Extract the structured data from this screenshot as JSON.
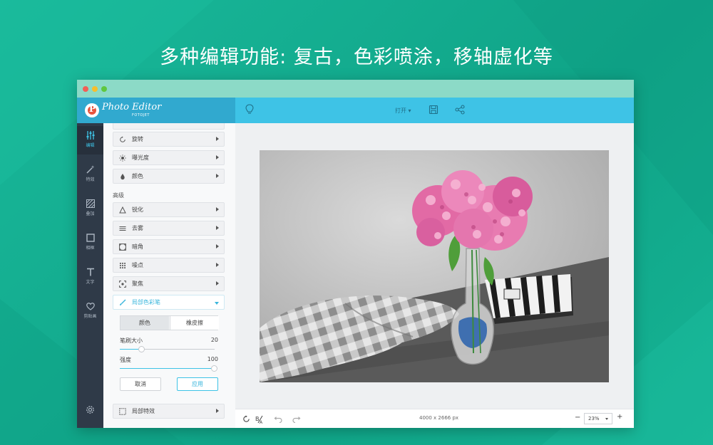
{
  "headline": "多种编辑功能: 复古，色彩喷涂，移轴虚化等",
  "app": {
    "brand_name": "Photo Editor",
    "brand_sub": "FOTOJET",
    "open_menu": "打开 ▾"
  },
  "rail": {
    "items": [
      {
        "label": "编辑",
        "icon": "sliders-icon"
      },
      {
        "label": "特效",
        "icon": "magic-wand-icon"
      },
      {
        "label": "叠加",
        "icon": "overlay-icon"
      },
      {
        "label": "相框",
        "icon": "frame-icon"
      },
      {
        "label": "文字",
        "icon": "text-icon"
      },
      {
        "label": "剪贴画",
        "icon": "heart-icon"
      }
    ]
  },
  "panel": {
    "basic_items": [
      {
        "label": "旋转",
        "icon": "rotate-icon"
      },
      {
        "label": "曝光度",
        "icon": "sun-icon"
      },
      {
        "label": "颜色",
        "icon": "drop-icon"
      }
    ],
    "section_label": "高级",
    "advanced_items": [
      {
        "label": "锐化",
        "icon": "triangle-icon"
      },
      {
        "label": "去雾",
        "icon": "haze-icon"
      },
      {
        "label": "暗角",
        "icon": "vignette-icon"
      },
      {
        "label": "噪点",
        "icon": "noise-icon"
      },
      {
        "label": "聚焦",
        "icon": "focus-icon"
      },
      {
        "label": "局部色彩笔",
        "icon": "brush-icon"
      }
    ],
    "brush_tabs": [
      "颜色",
      "橡皮擦"
    ],
    "brush_size_label": "笔刷大小",
    "brush_size_value": "20",
    "strength_label": "强度",
    "strength_value": "100",
    "cancel_label": "取消",
    "apply_label": "应用",
    "bottom_item": {
      "label": "局部特效",
      "icon": "dashed-square-icon"
    }
  },
  "canvas": {
    "dimensions": "4000 x 2666 px",
    "zoom": "23%"
  },
  "colors": {
    "background": "#12a98c",
    "accent": "#3ec3e6",
    "rail": "#2f3a48"
  }
}
